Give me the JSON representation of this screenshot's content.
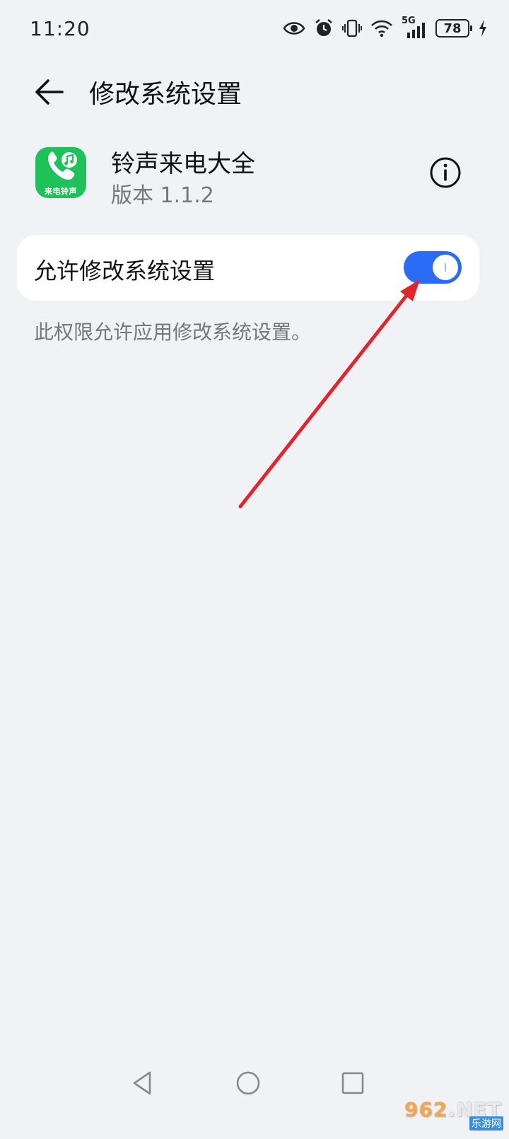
{
  "status_bar": {
    "time": "11:20",
    "icons": [
      "eye-icon",
      "alarm-icon",
      "vibrate-icon",
      "wifi-icon",
      "signal-5g-icon",
      "battery-icon",
      "charging-icon"
    ],
    "network_label": "5G",
    "battery_level": "78"
  },
  "header": {
    "back_icon": "arrow-left-icon",
    "title": "修改系统设置"
  },
  "app_info": {
    "name": "铃声来电大全",
    "version": "版本 1.1.2",
    "icon_caption": "来电铃声",
    "icon_color": "#1fc15a",
    "info_icon": "info-circle-icon"
  },
  "setting": {
    "label": "允许修改系统设置",
    "enabled": true,
    "toggle_color": "#2a6cf5",
    "description": "此权限允许应用修改系统设置。"
  },
  "annotation": {
    "color": "#e0252b",
    "points_to": "permission-toggle"
  },
  "nav_bar": {
    "buttons": [
      "nav-back-triangle-icon",
      "nav-home-circle-icon",
      "nav-recents-square-icon"
    ]
  },
  "watermark": {
    "top_prefix": "",
    "top_number": "962",
    "top_suffix": ".NET",
    "bottom": "乐游网"
  },
  "colors": {
    "background": "#f1f2f6",
    "card": "#ffffff",
    "secondary_text": "#777777"
  }
}
